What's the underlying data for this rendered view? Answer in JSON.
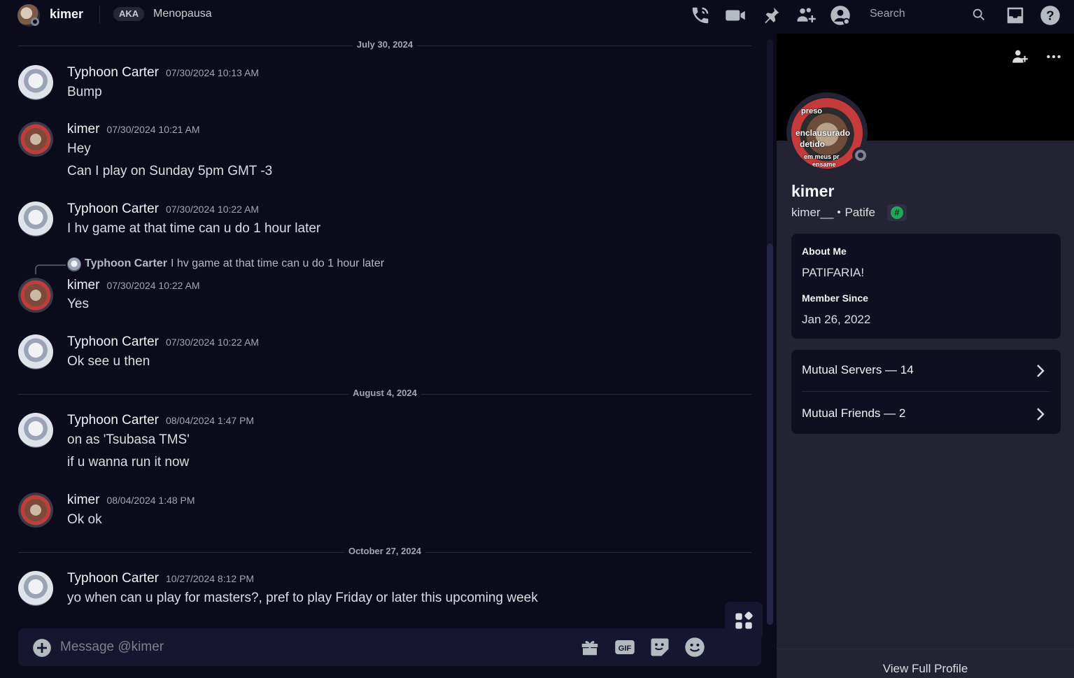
{
  "topbar": {
    "user_name": "kimer",
    "aka_label": "AKA",
    "aka_name": "Menopausa",
    "search_placeholder": "Search"
  },
  "dividers": [
    "July 30, 2024",
    "August 4, 2024",
    "October 27, 2024"
  ],
  "messages": [
    {
      "author": "Typhoon Carter",
      "timestamp": "07/30/2024 10:13 AM",
      "lines": [
        "Bump"
      ]
    },
    {
      "author": "kimer",
      "timestamp": "07/30/2024 10:21 AM",
      "lines": [
        "Hey",
        "Can I play on Sunday 5pm GMT -3"
      ]
    },
    {
      "author": "Typhoon Carter",
      "timestamp": "07/30/2024 10:22 AM",
      "lines": [
        "I hv game at that time can u do 1 hour later"
      ]
    },
    {
      "author": "kimer",
      "timestamp": "07/30/2024 10:22 AM",
      "lines": [
        "Yes"
      ],
      "reply_to": {
        "author": "Typhoon Carter",
        "text": "I hv game at that time can u do 1 hour later"
      }
    },
    {
      "author": "Typhoon Carter",
      "timestamp": "07/30/2024 10:22 AM",
      "lines": [
        "Ok see u then"
      ]
    },
    {
      "author": "Typhoon Carter",
      "timestamp": "08/04/2024 1:47 PM",
      "lines": [
        "on as 'Tsubasa TMS'",
        "if u wanna run it now"
      ]
    },
    {
      "author": "kimer",
      "timestamp": "08/04/2024 1:48 PM",
      "lines": [
        "Ok ok"
      ]
    },
    {
      "author": "Typhoon Carter",
      "timestamp": "10/27/2024 8:12 PM",
      "lines": [
        "yo when can u play for masters?, pref to play Friday or later this upcoming week"
      ]
    }
  ],
  "composer": {
    "placeholder": "Message @kimer"
  },
  "profile": {
    "avatar_text": [
      "preso",
      "enclausurado",
      "detido",
      "em meus pr",
      "ensame"
    ],
    "display_name": "kimer",
    "username": "kimer__",
    "pronoun": "Patife",
    "badge_symbol": "#",
    "about_heading": "About Me",
    "about_text": "PATIFARIA!",
    "member_since_heading": "Member Since",
    "member_since": "Jan 26, 2022",
    "mutual_servers": "Mutual Servers — 14",
    "mutual_friends": "Mutual Friends — 2",
    "view_full": "View Full Profile"
  },
  "icons": [
    "phone-call-icon",
    "video-camera-icon",
    "pin-icon",
    "add-friends-icon",
    "user-profile-icon",
    "search-icon",
    "inbox-icon",
    "help-icon",
    "add-friend-icon",
    "more-icon",
    "plus-circle-icon",
    "gift-icon",
    "gif-icon",
    "sticker-icon",
    "emoji-icon",
    "apps-icon",
    "chevron-right-icon"
  ],
  "colors": {
    "background": "#0b0b1c",
    "panel": "#232334",
    "card": "#0f0f22",
    "status_offline": "#80848e",
    "badge_green": "#23a55a"
  }
}
